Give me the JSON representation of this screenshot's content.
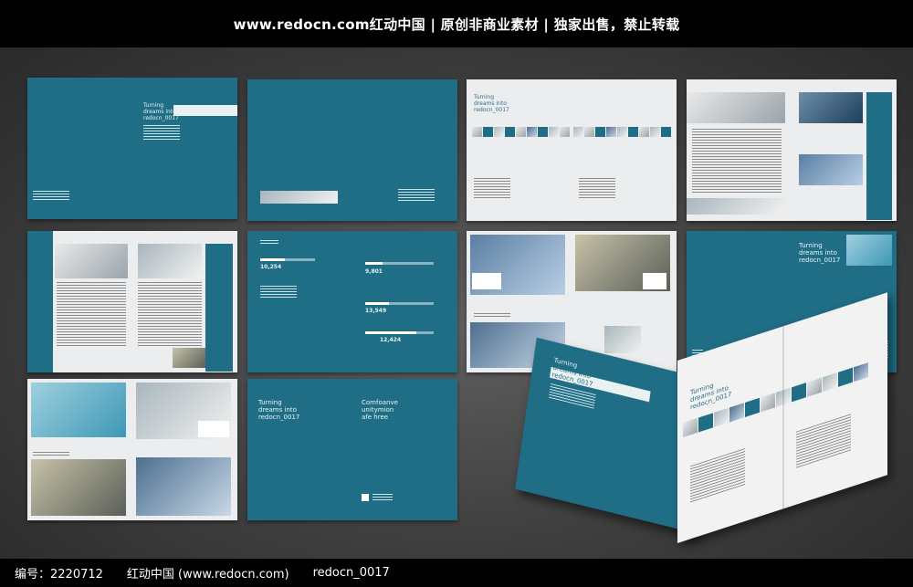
{
  "header": {
    "title": "www.redocn.com红动中国 | 原创非商业素材 | 独家出售，禁止转载"
  },
  "footer": {
    "id_text": "编号：2220712",
    "site_text": "红动中国 (www.redocn.com)",
    "code_text": "redocn_0017"
  },
  "brochure": {
    "cover_title_lines": [
      "Turning",
      "dreams into",
      "redocn_0017"
    ],
    "cover_title_short": [
      "Turning",
      "dreams into",
      "redocn_0017"
    ],
    "back_title": "Turning\ndreams into",
    "section_caption": "Redocn build",
    "section_sub": "Ssamsitor",
    "stats": [
      "10,254",
      "9,801",
      "13,549",
      "12,424"
    ],
    "slogan_lines": [
      "Comfoanve",
      "unitymion",
      "afe hree"
    ]
  },
  "colors": {
    "brand_teal": "#1f6e86",
    "page_light": "#ecedee",
    "header_bg": "#000000"
  }
}
